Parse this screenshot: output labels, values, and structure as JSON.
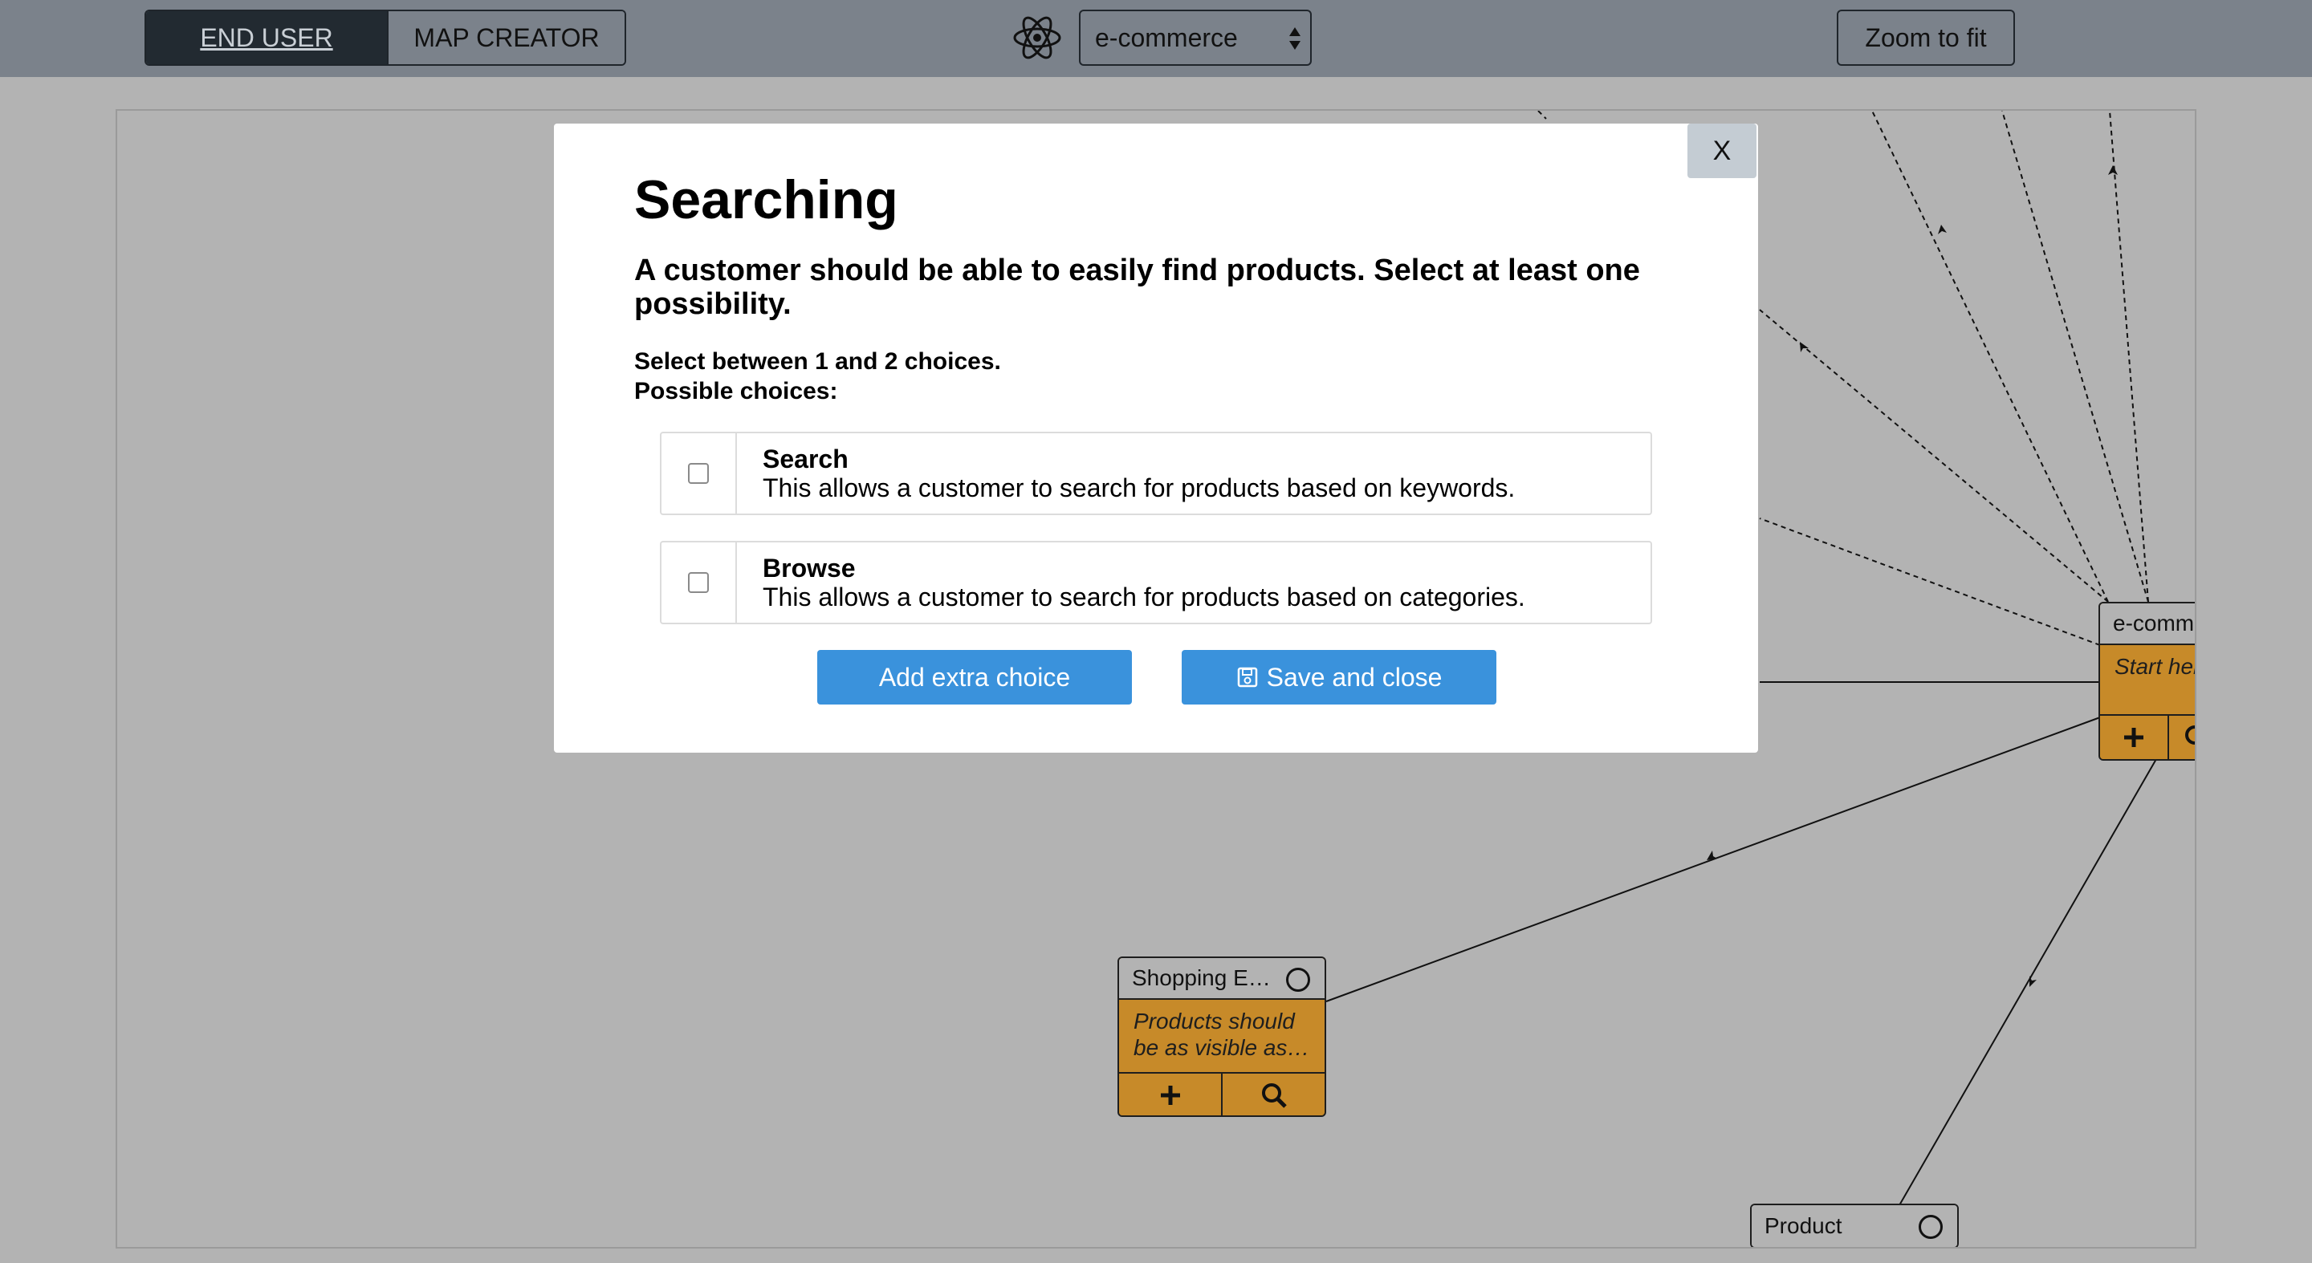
{
  "toolbar": {
    "modes": [
      "END USER",
      "MAP CREATOR"
    ],
    "active_mode": "END USER",
    "project_select": {
      "value": "e-commerce"
    },
    "zoom_label": "Zoom to fit",
    "logo_icon": "react-atom-icon"
  },
  "canvas": {
    "nodes": {
      "ecommerce": {
        "title": "e-comm",
        "description": "Start her",
        "actions": [
          "+",
          "Q"
        ]
      },
      "shopping": {
        "title": "Shopping E…",
        "description_line1": "Products should",
        "description_line2": "be as visible as…",
        "actions": [
          "plus-icon",
          "search-icon"
        ]
      },
      "product": {
        "title": "Product"
      }
    }
  },
  "modal": {
    "close_label": "X",
    "title": "Searching",
    "description": "A customer should be able to easily find products. Select at least one possibility.",
    "constraint": "Select between 1 and 2 choices.",
    "choices_label": "Possible choices:",
    "choices": [
      {
        "name": "Search",
        "description": "This allows a customer to search for products based on keywords.",
        "checked": false
      },
      {
        "name": "Browse",
        "description": "This allows a customer to search for products based on categories.",
        "checked": false
      }
    ],
    "add_choice_label": "Add extra choice",
    "save_label": "Save and close"
  },
  "colors": {
    "toolbar_bg": "#7b828b",
    "canvas_bg": "#b3b3b3",
    "node_fill": "#c78a29",
    "button_blue": "#3a92dc"
  }
}
